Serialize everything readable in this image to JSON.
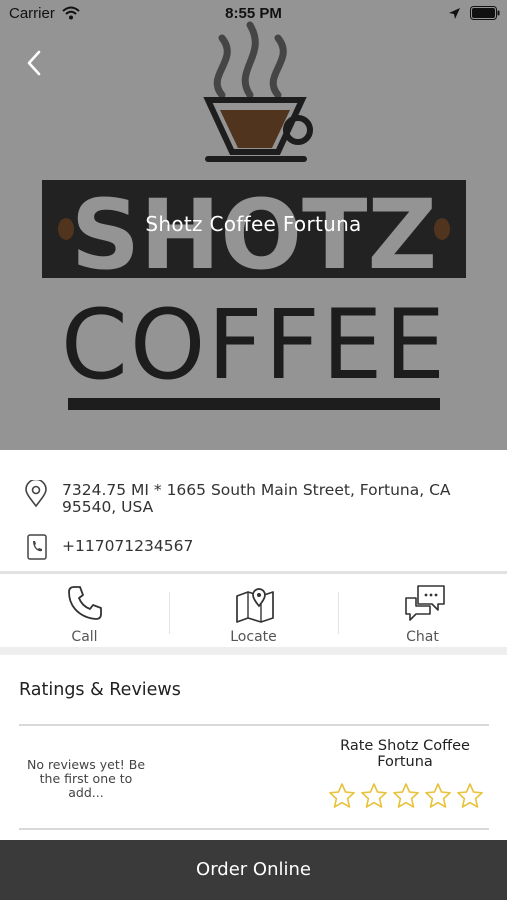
{
  "status_bar": {
    "carrier": "Carrier",
    "time": "8:55 PM",
    "icons": [
      "wifi-icon",
      "location-arrow-icon",
      "battery-icon"
    ]
  },
  "hero": {
    "title": "Shotz Coffee Fortuna",
    "logo_top_word": "SHOTZ",
    "logo_bottom_word": "COFFEE",
    "back_icon": "chevron-left-icon"
  },
  "business": {
    "address": "7324.75 MI * 1665 South Main Street, Fortuna, CA 95540, USA",
    "phone": "+117071234567"
  },
  "actions": [
    {
      "label": "Call",
      "icon": "phone-icon"
    },
    {
      "label": "Locate",
      "icon": "map-pin-icon"
    },
    {
      "label": "Chat",
      "icon": "chat-bubbles-icon"
    }
  ],
  "reviews": {
    "title": "Ratings & Reviews",
    "empty_text": "No reviews yet! Be the first one to add...",
    "rate_label": "Rate Shotz Coffee Fortuna",
    "star_count": 5,
    "current_rating": 0,
    "star_color": "#e8c23a"
  },
  "footer": {
    "order_label": "Order Online",
    "color": "#3a3a3a"
  }
}
